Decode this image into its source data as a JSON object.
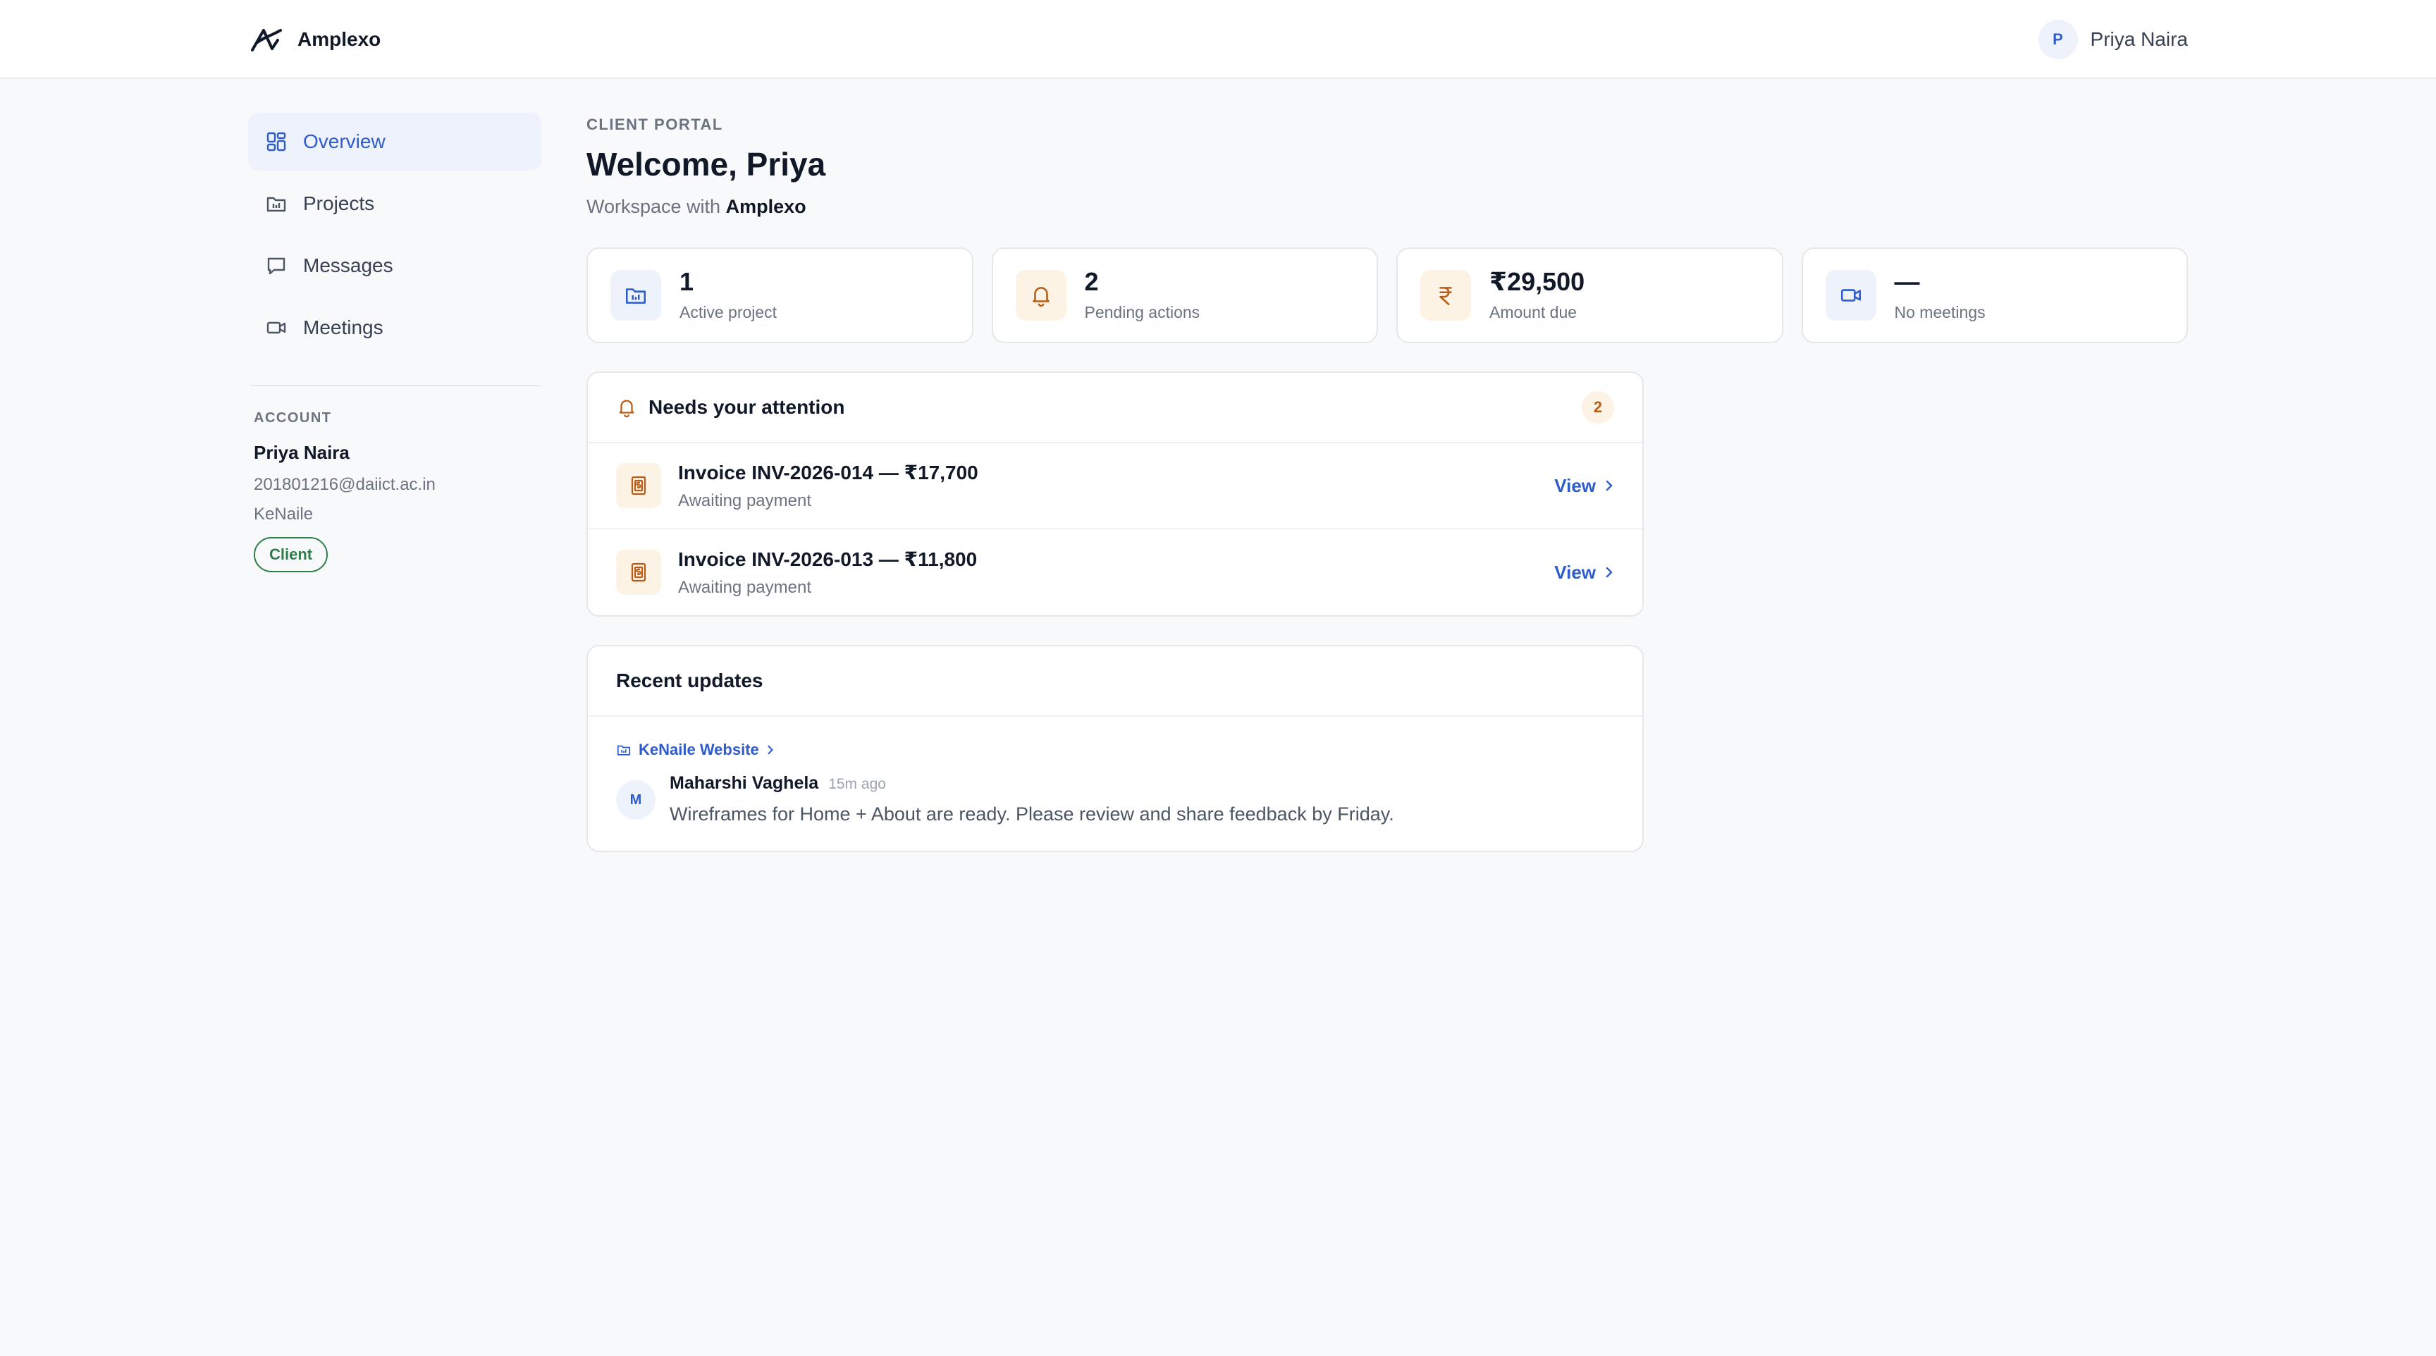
{
  "header": {
    "brand_name": "Amplexo",
    "user_initial": "P",
    "user_name": "Priya Naira"
  },
  "sidebar": {
    "items": [
      {
        "label": "Overview",
        "icon": "grid-icon",
        "active": true
      },
      {
        "label": "Projects",
        "icon": "folder-icon",
        "active": false
      },
      {
        "label": "Messages",
        "icon": "chat-icon",
        "active": false
      },
      {
        "label": "Meetings",
        "icon": "video-icon",
        "active": false
      }
    ],
    "account": {
      "heading": "ACCOUNT",
      "name": "Priya Naira",
      "email": "201801216@daiict.ac.in",
      "company": "KeNaile",
      "role": "Client"
    }
  },
  "main": {
    "eyebrow": "CLIENT PORTAL",
    "welcome": "Welcome, Priya",
    "workspace_prefix": "Workspace with",
    "workspace_name": "Amplexo",
    "stats": [
      {
        "value": "1",
        "label": "Active project",
        "icon": "folder-icon",
        "tone": "blue"
      },
      {
        "value": "2",
        "label": "Pending actions",
        "icon": "bell-icon",
        "tone": "amber"
      },
      {
        "value": "₹29,500",
        "label": "Amount due",
        "icon": "rupee-icon",
        "tone": "amber"
      },
      {
        "value": "—",
        "label": "No meetings",
        "icon": "video-icon",
        "tone": "blue"
      }
    ],
    "attention": {
      "title": "Needs your attention",
      "count": "2",
      "items": [
        {
          "title": "Invoice INV-2026-014 — ₹17,700",
          "status": "Awaiting payment",
          "action": "View"
        },
        {
          "title": "Invoice INV-2026-013 — ₹11,800",
          "status": "Awaiting payment",
          "action": "View"
        }
      ]
    },
    "updates": {
      "title": "Recent updates",
      "project": "KeNaile Website",
      "author_initial": "M",
      "author": "Maharshi Vaghela",
      "time": "15m ago",
      "text": "Wireframes for Home + About are ready. Please review and share feedback by Friday."
    }
  },
  "colors": {
    "accent": "#2f5ccc",
    "amber": "#b75d17",
    "client_badge": "#2f7d4a",
    "background": "#f8f9fb"
  }
}
